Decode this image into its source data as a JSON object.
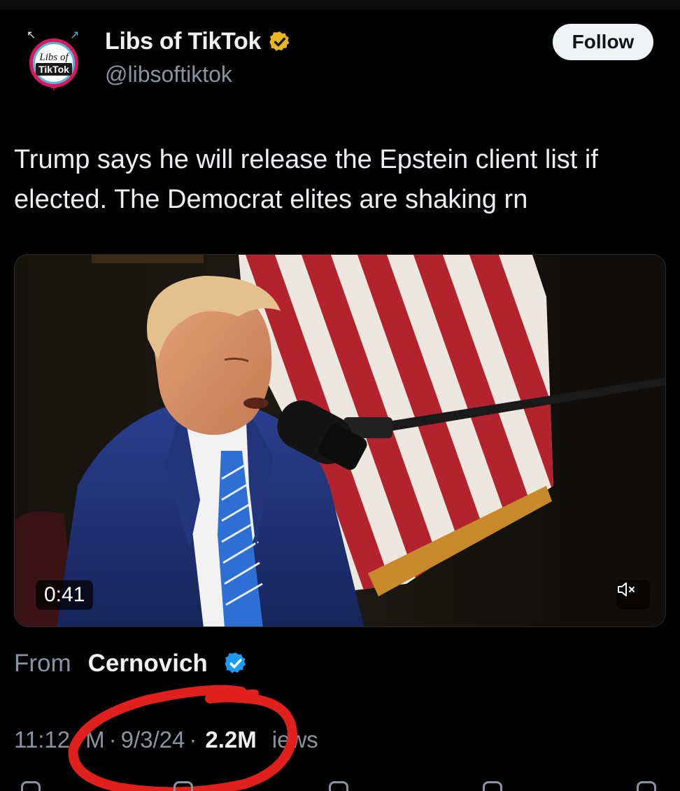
{
  "header": {
    "avatar_text_line1": "Libs of",
    "avatar_text_line2": "TikTok",
    "display_name": "Libs of TikTok",
    "handle": "@libsoftiktok",
    "follow_label": "Follow",
    "verified_badge": "gold-verified-icon"
  },
  "tweet": {
    "text": "Trump says he will release the Epstein client list if elected. The Democrat elites are shaking rn"
  },
  "media": {
    "duration": "0:41",
    "mute_icon": "speaker-muted-icon"
  },
  "source": {
    "from_label": "From",
    "from_name": "Cernovich",
    "verified_badge": "blue-verified-icon"
  },
  "meta": {
    "time": "11:12",
    "time_tail": "M",
    "date": "9/3/24",
    "views_count": "2.2M",
    "views_tail": "iews"
  },
  "colors": {
    "background": "#000000",
    "text_primary": "#e7e9ea",
    "text_secondary": "#8b949e",
    "gold_badge": "#e8b620",
    "blue_badge": "#1d9bf0",
    "annotation_red": "#e0201c",
    "follow_bg": "#eff3f4"
  }
}
